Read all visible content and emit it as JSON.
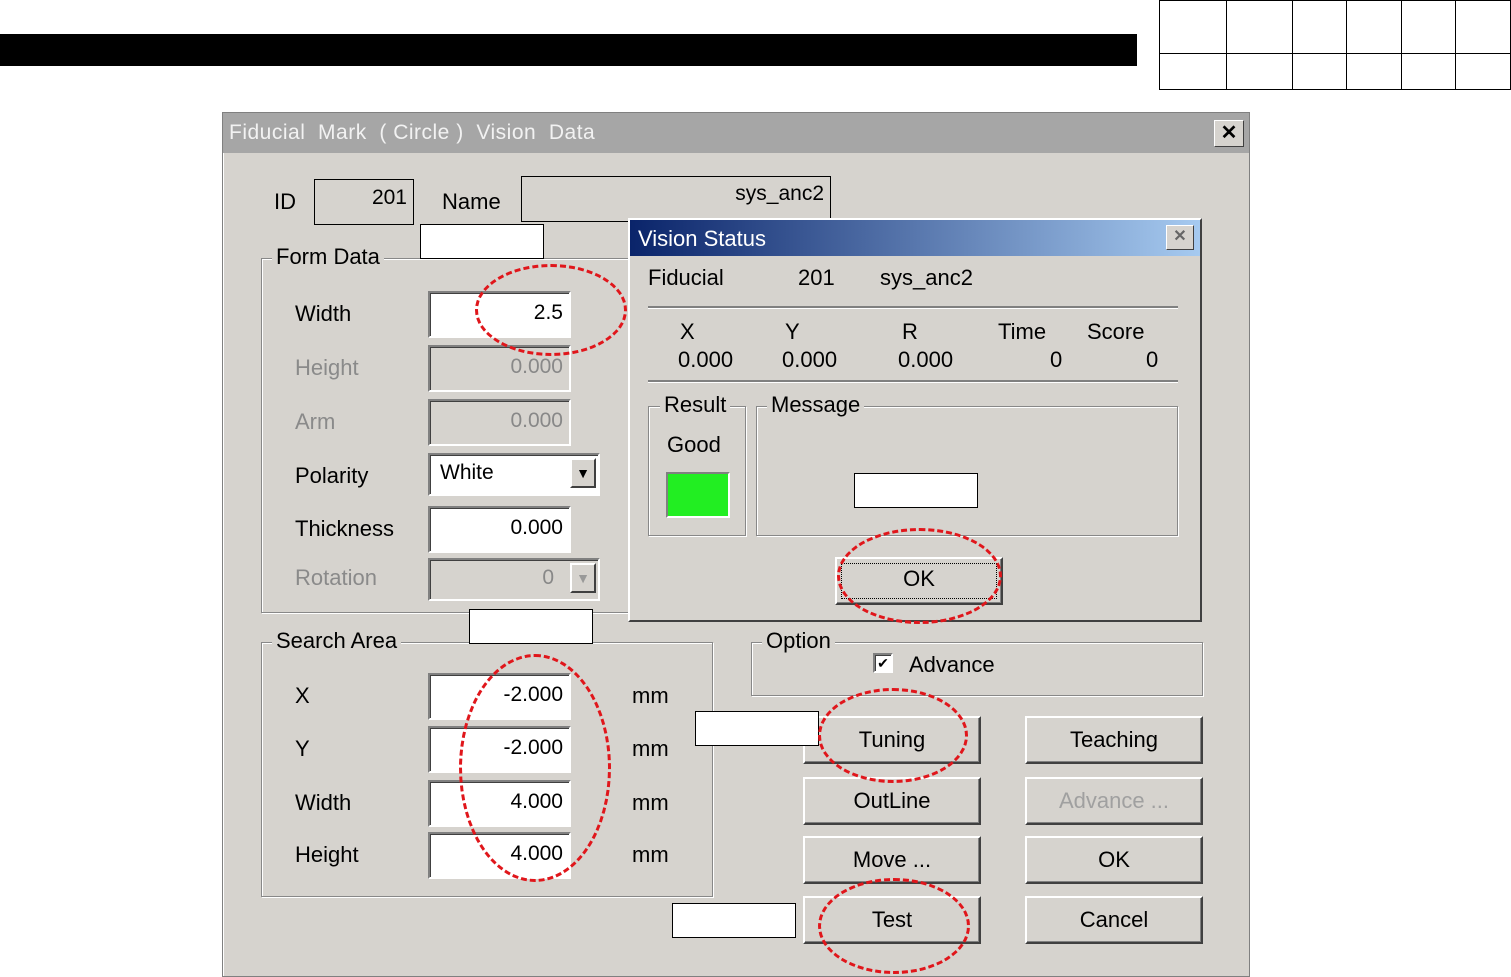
{
  "dialog": {
    "title": "Fiducial  Mark  ( Circle )  Vision  Data",
    "close_glyph": "✕",
    "id_label": "ID",
    "id_value": "201",
    "name_label": "Name",
    "name_value": "sys_anc2",
    "form_data": {
      "title": "Form Data",
      "width_label": "Width",
      "width_value": "2.5",
      "height_label": "Height",
      "height_value": "0.000",
      "arm_label": "Arm",
      "arm_value": "0.000",
      "polarity_label": "Polarity",
      "polarity_value": "White",
      "thickness_label": "Thickness",
      "thickness_value": "0.000",
      "rotation_label": "Rotation",
      "rotation_value": "0"
    },
    "search_area": {
      "title": "Search Area",
      "x_label": "X",
      "x_value": "-2.000",
      "y_label": "Y",
      "y_value": "-2.000",
      "width_label": "Width",
      "width_value": "4.000",
      "height_label": "Height",
      "height_value": "4.000",
      "unit": "mm"
    },
    "option": {
      "title": "Option",
      "advance_label": "Advance",
      "advance_checked": true,
      "check_glyph": "✔"
    },
    "buttons": {
      "tuning": "Tuning",
      "teaching": "Teaching",
      "outline": "OutLine",
      "advance": "Advance ...",
      "move": "Move ...",
      "ok": "OK",
      "test": "Test",
      "cancel": "Cancel"
    },
    "combo_arrow_glyph": "▼"
  },
  "vision_status": {
    "title": "Vision Status",
    "close_glyph": "✕",
    "fiducial_label": "Fiducial",
    "fiducial_id": "201",
    "fiducial_name": "sys_anc2",
    "columns": [
      "X",
      "Y",
      "R",
      "Time",
      "Score"
    ],
    "values": [
      "0.000",
      "0.000",
      "0.000",
      "0",
      "0"
    ],
    "result_title": "Result",
    "result_value": "Good",
    "result_color": "#22ee22",
    "message_title": "Message",
    "ok_label": "OK"
  },
  "annotation_color": "#e0161b"
}
